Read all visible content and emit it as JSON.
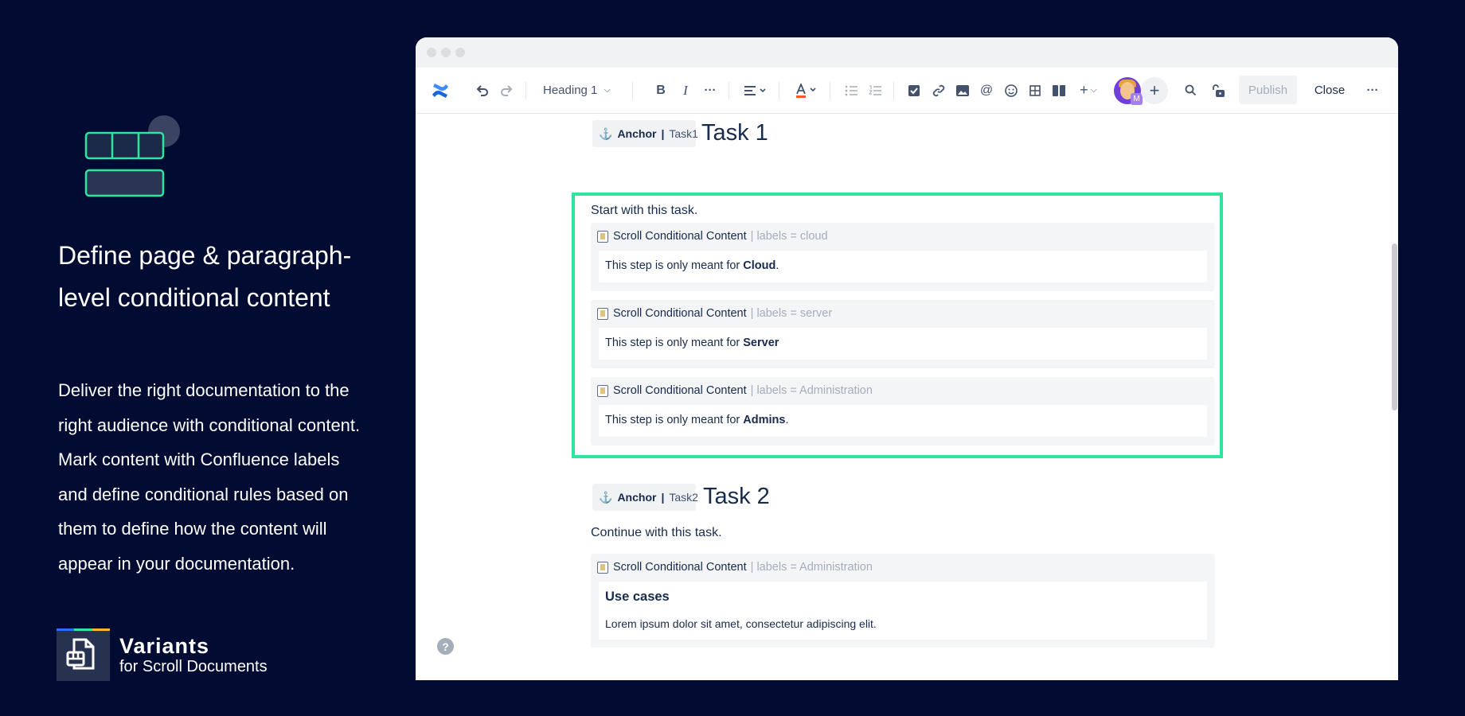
{
  "hero": {
    "title": "Define page & paragraph-level conditional content",
    "body": "Deliver the right documentation to the right audience with conditional content. Mark content with Confluence labels and define conditional rules based on them to define how the content will appear in your documentation."
  },
  "brand": {
    "name": "Variants",
    "sub": "for Scroll Documents",
    "stripe_colors": [
      "#2f6df6",
      "#2ee59d",
      "#f5b82e"
    ]
  },
  "colors": {
    "background": "#020c33",
    "accent": "#2ee59d"
  },
  "toolbar": {
    "text_style": "Heading 1",
    "publish": "Publish",
    "close": "Close",
    "avatar_badge": "M"
  },
  "editor": {
    "task1": {
      "anchor_label": "Anchor",
      "anchor_value": "Task1",
      "heading": "Task 1",
      "intro": "Start with this task."
    },
    "task2": {
      "anchor_label": "Anchor",
      "anchor_value": "Task2",
      "heading": "Task 2",
      "intro": "Continue with this task."
    },
    "macros": [
      {
        "title": "Scroll Conditional Content",
        "labels": "| labels = cloud",
        "text_prefix": "This step is only meant for ",
        "text_bold": "Cloud",
        "text_suffix": "."
      },
      {
        "title": "Scroll Conditional Content",
        "labels": "| labels = server",
        "text_prefix": "This step is only meant for ",
        "text_bold": "Server",
        "text_suffix": ""
      },
      {
        "title": "Scroll Conditional Content",
        "labels": "| labels = Administration",
        "text_prefix": "This step is only meant for ",
        "text_bold": "Admins",
        "text_suffix": "."
      },
      {
        "title": "Scroll Conditional Content",
        "labels": "| labels = Administration",
        "heading": "Use cases",
        "lorem": "Lorem ipsum dolor sit amet, consectetur adipiscing elit."
      }
    ]
  },
  "help": "?"
}
